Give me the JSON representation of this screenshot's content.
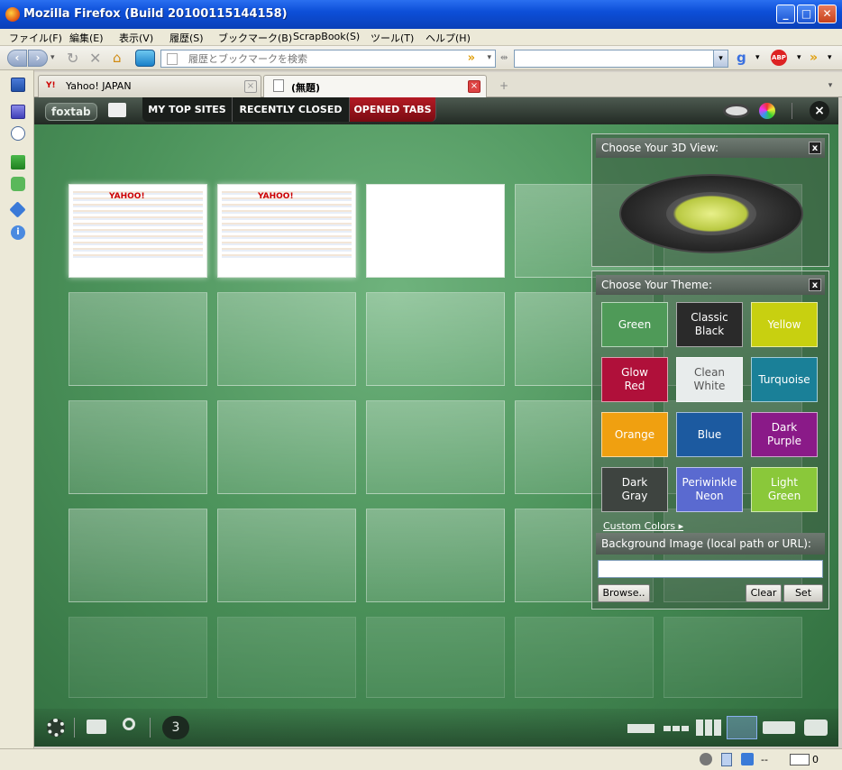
{
  "window": {
    "title": "Mozilla Firefox (Build 20100115144158)"
  },
  "menu": [
    "ファイル(F)",
    "編集(E)",
    "表示(V)",
    "履歴(S)",
    "ブックマーク(B)",
    "ScrapBook(S)",
    "ツール(T)",
    "ヘルプ(H)"
  ],
  "urlbar": {
    "placeholder": "履歴とブックマークを検索"
  },
  "tabs": [
    {
      "label": "Yahoo! JAPAN"
    },
    {
      "label": "(無題)"
    }
  ],
  "foxtab": {
    "logo": "foxtab",
    "nav": [
      "MY TOP SITES",
      "RECENTLY CLOSED",
      "OPENED TABS"
    ],
    "selected_nav": "OPENED TABS",
    "tab_count": "3"
  },
  "thumbs": {
    "page_logo": "YAHOO!"
  },
  "view_panel": {
    "title": "Choose Your 3D View:",
    "close": "x"
  },
  "theme_panel": {
    "title": "Choose Your Theme:",
    "close": "x",
    "themes": [
      {
        "line1": "Green",
        "line2": "",
        "color": "#4f9a58"
      },
      {
        "line1": "Classic",
        "line2": "Black",
        "color": "#2a2a2a"
      },
      {
        "line1": "Yellow",
        "line2": "",
        "color": "#c8d010"
      },
      {
        "line1": "Glow",
        "line2": "Red",
        "color": "#b0103a"
      },
      {
        "line1": "Clean",
        "line2": "White",
        "color": "#e8ecec"
      },
      {
        "line1": "Turquoise",
        "line2": "",
        "color": "#1a8098"
      },
      {
        "line1": "Orange",
        "line2": "",
        "color": "#f0a010"
      },
      {
        "line1": "Blue",
        "line2": "",
        "color": "#1c5aa0"
      },
      {
        "line1": "Dark",
        "line2": "Purple",
        "color": "#8a1a88"
      },
      {
        "line1": "Dark",
        "line2": "Gray",
        "color": "#3e4440"
      },
      {
        "line1": "Periwinkle",
        "line2": "Neon",
        "color": "#5a6ad0"
      },
      {
        "line1": "Light",
        "line2": "Green",
        "color": "#8ac83a"
      }
    ],
    "custom_colors": "Custom Colors",
    "background_label": "Background Image (local path or URL):",
    "background_value": "",
    "browse": "Browse..",
    "clear": "Clear",
    "set": "Set"
  },
  "statusbar": {
    "dashes": "--",
    "mail_count": "0"
  }
}
